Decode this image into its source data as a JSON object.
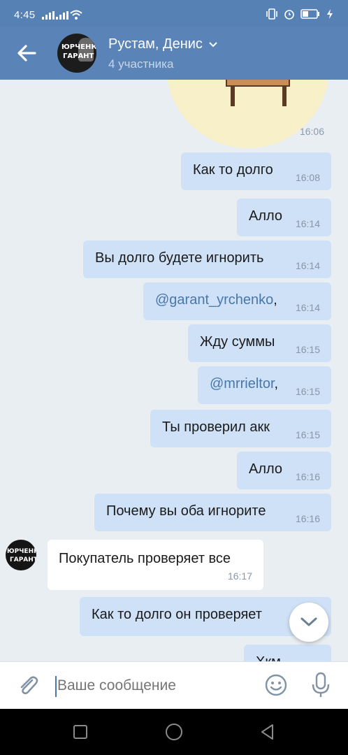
{
  "status_bar": {
    "time": "4:45"
  },
  "header": {
    "back_label": "←",
    "title": "Рустам, Денис",
    "subtitle": "4 участника",
    "avatar_text_line1": "ЮРЧЕНКО",
    "avatar_text_line2": "ГАРАНТ"
  },
  "sticker": {
    "time": "16:06"
  },
  "messages": [
    {
      "text": "Как то долго",
      "time": "16:08"
    },
    {
      "text": "Алло",
      "time": "16:14"
    },
    {
      "text": "Вы долго будете игнорить",
      "time": "16:14"
    },
    {
      "mention": "@garant_yrchenko",
      "suffix": ",",
      "time": "16:14"
    },
    {
      "text": "Жду суммы",
      "time": "16:15"
    },
    {
      "mention": "@mrrieltor",
      "suffix": ",",
      "time": "16:15"
    },
    {
      "text": "Ты проверил акк",
      "time": "16:15"
    },
    {
      "text": "Алло",
      "time": "16:16"
    },
    {
      "text": "Почему вы оба игнорите",
      "time": "16:16"
    },
    {
      "text": "Как то долго он проверяет",
      "time": ""
    },
    {
      "text": "Хкм",
      "time": ""
    }
  ],
  "incoming": {
    "text": "Покупатель проверяет все",
    "time": "16:17",
    "avatar_line1": "ЮРЧЕНКО",
    "avatar_line2": "ГАРАНТ"
  },
  "composer": {
    "placeholder": "Ваше сообщение"
  },
  "colors": {
    "header": "#5a84b7",
    "out_bubble": "#cfe1f6",
    "background": "#e9eef3",
    "accent": "#4a76a8"
  },
  "icons": [
    "back-arrow-icon",
    "chevron-down-icon",
    "attach-icon",
    "emoji-icon",
    "mic-icon",
    "scroll-down-icon",
    "nav-recent-icon",
    "nav-home-icon",
    "nav-back-icon"
  ]
}
